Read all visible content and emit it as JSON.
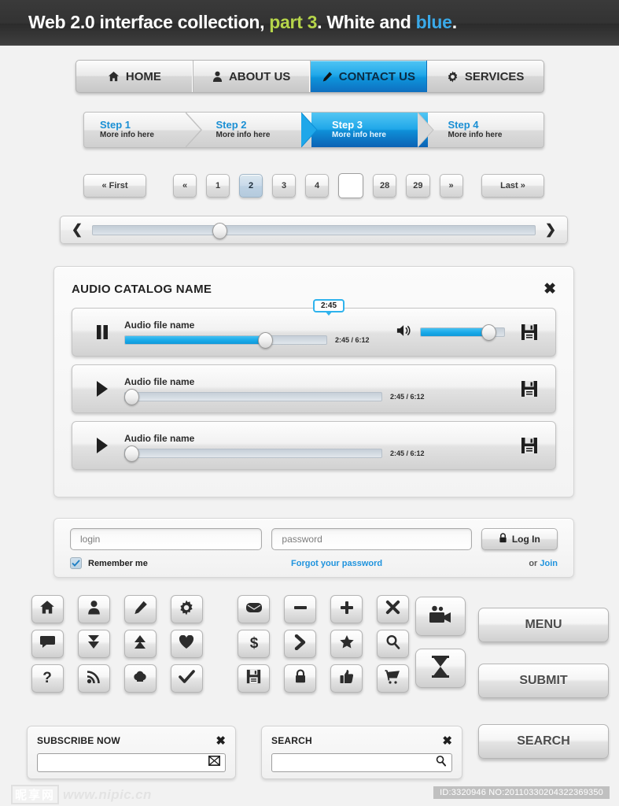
{
  "header": {
    "title_part1": "Web 2.0 interface collection, ",
    "title_green": "part 3",
    "title_part2": ". White and ",
    "title_blue": "blue",
    "title_end": "."
  },
  "colors": {
    "accent_blue": "#18a9e8",
    "link_blue": "#1f93dd",
    "highlight_green": "#b5d44a",
    "dark_header": "#333333"
  },
  "nav": {
    "items": [
      {
        "label": "HOME",
        "icon": "home-icon",
        "active": false
      },
      {
        "label": "ABOUT US",
        "icon": "user-icon",
        "active": false
      },
      {
        "label": "CONTACT US",
        "icon": "pencil-icon",
        "active": true
      },
      {
        "label": "SERVICES",
        "icon": "gear-icon",
        "active": false
      }
    ]
  },
  "steps": {
    "items": [
      {
        "title": "Step 1",
        "sub": "More info here",
        "active": false
      },
      {
        "title": "Step 2",
        "sub": "More info here",
        "active": false
      },
      {
        "title": "Step 3",
        "sub": "More info here",
        "active": true
      },
      {
        "title": "Step 4",
        "sub": "More info here",
        "active": false
      }
    ]
  },
  "pagination": {
    "first_label": "« First",
    "prev_label": "«",
    "pages": [
      "1",
      "2",
      "3",
      "4"
    ],
    "current_page": "2",
    "input_value": "",
    "more_pages": [
      "28",
      "29"
    ],
    "next_label": "»",
    "last_label": "Last »"
  },
  "slider": {
    "left_arrow": "❮",
    "right_arrow": "❯",
    "value_percent": 27
  },
  "audio": {
    "panel_title": "AUDIO CATALOG NAME",
    "close_icon": "✖",
    "tracks": [
      {
        "name": "Audio file name",
        "state": "playing",
        "transport_icon": "pause-icon",
        "tooltip_time": "2:45",
        "time_label": "2:45 / 6:12",
        "progress_percent": 72,
        "volume_percent": 80,
        "has_volume": true,
        "save_icon": "save-icon"
      },
      {
        "name": "Audio file name",
        "state": "paused",
        "transport_icon": "play-icon",
        "tooltip_time": "",
        "time_label": "2:45 / 6:12",
        "progress_percent": 0,
        "volume_percent": 0,
        "has_volume": false,
        "save_icon": "save-icon"
      },
      {
        "name": "Audio file name",
        "state": "paused",
        "transport_icon": "play-icon",
        "tooltip_time": "",
        "time_label": "2:45 / 6:12",
        "progress_percent": 0,
        "volume_percent": 0,
        "has_volume": false,
        "save_icon": "save-icon"
      }
    ]
  },
  "login": {
    "login_placeholder": "login",
    "login_value": "",
    "password_placeholder": "password",
    "password_value": "",
    "login_button": "Log In",
    "login_button_icon": "lock-icon",
    "remember_label": "Remember me",
    "remember_checked": true,
    "forgot_label": "Forgot your password",
    "or_label": "or ",
    "join_label": "Join"
  },
  "icons": {
    "row1": [
      "home-icon",
      "user-icon",
      "pencil-icon",
      "gear-icon",
      "mail-icon",
      "minus-icon",
      "plus-icon",
      "close-icon"
    ],
    "row2": [
      "comment-icon",
      "download-icon",
      "upload-icon",
      "heart-icon",
      "dollar-icon",
      "arrow-right-icon",
      "star-icon",
      "search-icon"
    ],
    "row3": [
      "help-icon",
      "rss-icon",
      "cloud-icon",
      "check-icon",
      "save-icon",
      "lock-icon",
      "thumbs-up-icon",
      "cart-icon"
    ],
    "big": [
      "video-camera-icon",
      "hourglass-icon"
    ]
  },
  "buttons": {
    "menu": "MENU",
    "submit": "SUBMIT",
    "search": "SEARCH"
  },
  "subscribe": {
    "title": "SUBSCRIBE NOW",
    "close_icon": "✖",
    "field_value": "",
    "field_icon": "envelope-icon"
  },
  "search_box": {
    "title": "SEARCH",
    "close_icon": "✖",
    "field_value": "",
    "field_icon": "magnifier-icon"
  },
  "footer": {
    "watermark_cjk": "昵享网",
    "watermark_url": "www.nipic.cn",
    "id_tag": "ID:3320946 NO:20110330204322369350"
  }
}
